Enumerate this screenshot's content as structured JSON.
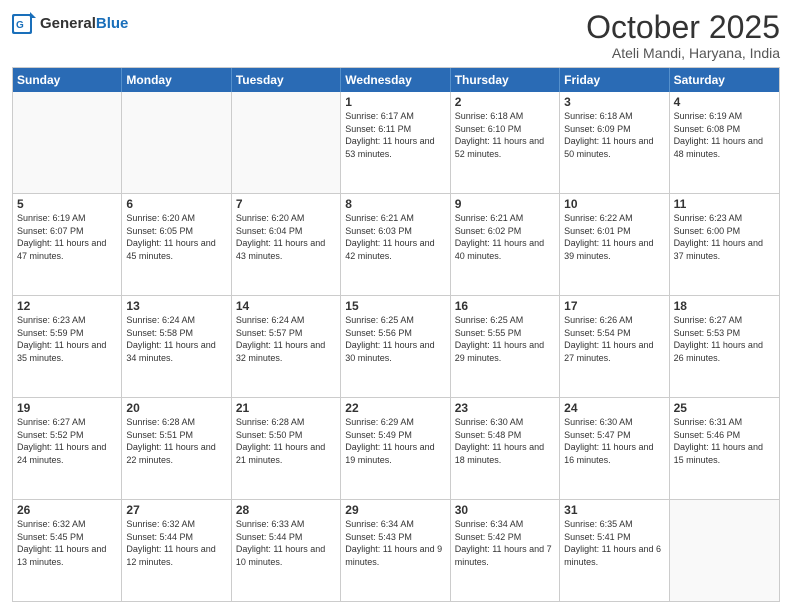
{
  "header": {
    "logo_general": "General",
    "logo_blue": "Blue",
    "month_title": "October 2025",
    "location": "Ateli Mandi, Haryana, India"
  },
  "days_of_week": [
    "Sunday",
    "Monday",
    "Tuesday",
    "Wednesday",
    "Thursday",
    "Friday",
    "Saturday"
  ],
  "rows": [
    [
      {
        "day": "",
        "empty": true
      },
      {
        "day": "",
        "empty": true
      },
      {
        "day": "",
        "empty": true
      },
      {
        "day": "1",
        "sunrise": "6:17 AM",
        "sunset": "6:11 PM",
        "daylight": "11 hours and 53 minutes."
      },
      {
        "day": "2",
        "sunrise": "6:18 AM",
        "sunset": "6:10 PM",
        "daylight": "11 hours and 52 minutes."
      },
      {
        "day": "3",
        "sunrise": "6:18 AM",
        "sunset": "6:09 PM",
        "daylight": "11 hours and 50 minutes."
      },
      {
        "day": "4",
        "sunrise": "6:19 AM",
        "sunset": "6:08 PM",
        "daylight": "11 hours and 48 minutes."
      }
    ],
    [
      {
        "day": "5",
        "sunrise": "6:19 AM",
        "sunset": "6:07 PM",
        "daylight": "11 hours and 47 minutes."
      },
      {
        "day": "6",
        "sunrise": "6:20 AM",
        "sunset": "6:05 PM",
        "daylight": "11 hours and 45 minutes."
      },
      {
        "day": "7",
        "sunrise": "6:20 AM",
        "sunset": "6:04 PM",
        "daylight": "11 hours and 43 minutes."
      },
      {
        "day": "8",
        "sunrise": "6:21 AM",
        "sunset": "6:03 PM",
        "daylight": "11 hours and 42 minutes."
      },
      {
        "day": "9",
        "sunrise": "6:21 AM",
        "sunset": "6:02 PM",
        "daylight": "11 hours and 40 minutes."
      },
      {
        "day": "10",
        "sunrise": "6:22 AM",
        "sunset": "6:01 PM",
        "daylight": "11 hours and 39 minutes."
      },
      {
        "day": "11",
        "sunrise": "6:23 AM",
        "sunset": "6:00 PM",
        "daylight": "11 hours and 37 minutes."
      }
    ],
    [
      {
        "day": "12",
        "sunrise": "6:23 AM",
        "sunset": "5:59 PM",
        "daylight": "11 hours and 35 minutes."
      },
      {
        "day": "13",
        "sunrise": "6:24 AM",
        "sunset": "5:58 PM",
        "daylight": "11 hours and 34 minutes."
      },
      {
        "day": "14",
        "sunrise": "6:24 AM",
        "sunset": "5:57 PM",
        "daylight": "11 hours and 32 minutes."
      },
      {
        "day": "15",
        "sunrise": "6:25 AM",
        "sunset": "5:56 PM",
        "daylight": "11 hours and 30 minutes."
      },
      {
        "day": "16",
        "sunrise": "6:25 AM",
        "sunset": "5:55 PM",
        "daylight": "11 hours and 29 minutes."
      },
      {
        "day": "17",
        "sunrise": "6:26 AM",
        "sunset": "5:54 PM",
        "daylight": "11 hours and 27 minutes."
      },
      {
        "day": "18",
        "sunrise": "6:27 AM",
        "sunset": "5:53 PM",
        "daylight": "11 hours and 26 minutes."
      }
    ],
    [
      {
        "day": "19",
        "sunrise": "6:27 AM",
        "sunset": "5:52 PM",
        "daylight": "11 hours and 24 minutes."
      },
      {
        "day": "20",
        "sunrise": "6:28 AM",
        "sunset": "5:51 PM",
        "daylight": "11 hours and 22 minutes."
      },
      {
        "day": "21",
        "sunrise": "6:28 AM",
        "sunset": "5:50 PM",
        "daylight": "11 hours and 21 minutes."
      },
      {
        "day": "22",
        "sunrise": "6:29 AM",
        "sunset": "5:49 PM",
        "daylight": "11 hours and 19 minutes."
      },
      {
        "day": "23",
        "sunrise": "6:30 AM",
        "sunset": "5:48 PM",
        "daylight": "11 hours and 18 minutes."
      },
      {
        "day": "24",
        "sunrise": "6:30 AM",
        "sunset": "5:47 PM",
        "daylight": "11 hours and 16 minutes."
      },
      {
        "day": "25",
        "sunrise": "6:31 AM",
        "sunset": "5:46 PM",
        "daylight": "11 hours and 15 minutes."
      }
    ],
    [
      {
        "day": "26",
        "sunrise": "6:32 AM",
        "sunset": "5:45 PM",
        "daylight": "11 hours and 13 minutes."
      },
      {
        "day": "27",
        "sunrise": "6:32 AM",
        "sunset": "5:44 PM",
        "daylight": "11 hours and 12 minutes."
      },
      {
        "day": "28",
        "sunrise": "6:33 AM",
        "sunset": "5:44 PM",
        "daylight": "11 hours and 10 minutes."
      },
      {
        "day": "29",
        "sunrise": "6:34 AM",
        "sunset": "5:43 PM",
        "daylight": "11 hours and 9 minutes."
      },
      {
        "day": "30",
        "sunrise": "6:34 AM",
        "sunset": "5:42 PM",
        "daylight": "11 hours and 7 minutes."
      },
      {
        "day": "31",
        "sunrise": "6:35 AM",
        "sunset": "5:41 PM",
        "daylight": "11 hours and 6 minutes."
      },
      {
        "day": "",
        "empty": true
      }
    ]
  ]
}
